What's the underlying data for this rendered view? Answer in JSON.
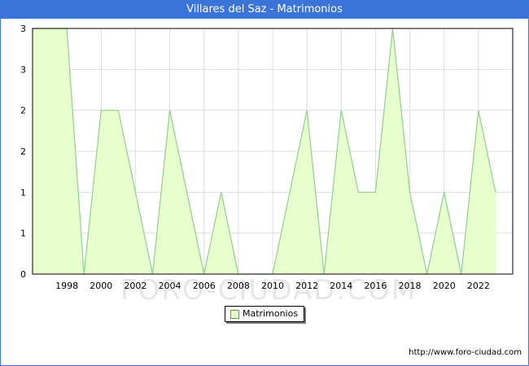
{
  "header": {
    "title": "Villares del Saz - Matrimonios"
  },
  "footer": {
    "url": "http://www.foro-ciudad.com"
  },
  "watermark": "FORO-CIUDAD.COM",
  "chart_data": {
    "type": "area",
    "title": "Villares del Saz - Matrimonios",
    "x": [
      1996,
      1997,
      1998,
      1999,
      2000,
      2001,
      2002,
      2003,
      2004,
      2005,
      2006,
      2007,
      2008,
      2009,
      2010,
      2011,
      2012,
      2013,
      2014,
      2015,
      2016,
      2017,
      2018,
      2019,
      2020,
      2021,
      2022,
      2023
    ],
    "series": [
      {
        "name": "Matrimonios",
        "values": [
          3,
          3,
          3,
          0,
          2,
          2,
          1,
          0,
          2,
          1,
          0,
          1,
          0,
          0,
          0,
          1,
          2,
          0,
          2,
          1,
          1,
          3,
          1,
          0,
          1,
          0,
          2,
          1
        ]
      }
    ],
    "x_ticks": [
      "1998",
      "2000",
      "2002",
      "2004",
      "2006",
      "2008",
      "2010",
      "2012",
      "2014",
      "2016",
      "2018",
      "2020",
      "2022"
    ],
    "y_ticks": [
      "0",
      "1",
      "1",
      "2",
      "2",
      "3",
      "3"
    ],
    "ylim": [
      0,
      3
    ],
    "grid": true,
    "legend": "bottom-center",
    "colors": {
      "fill": "#e6ffcc",
      "line": "#8fcf8f",
      "grid": "#dddddd",
      "title_bar": "#3a74d8"
    }
  }
}
